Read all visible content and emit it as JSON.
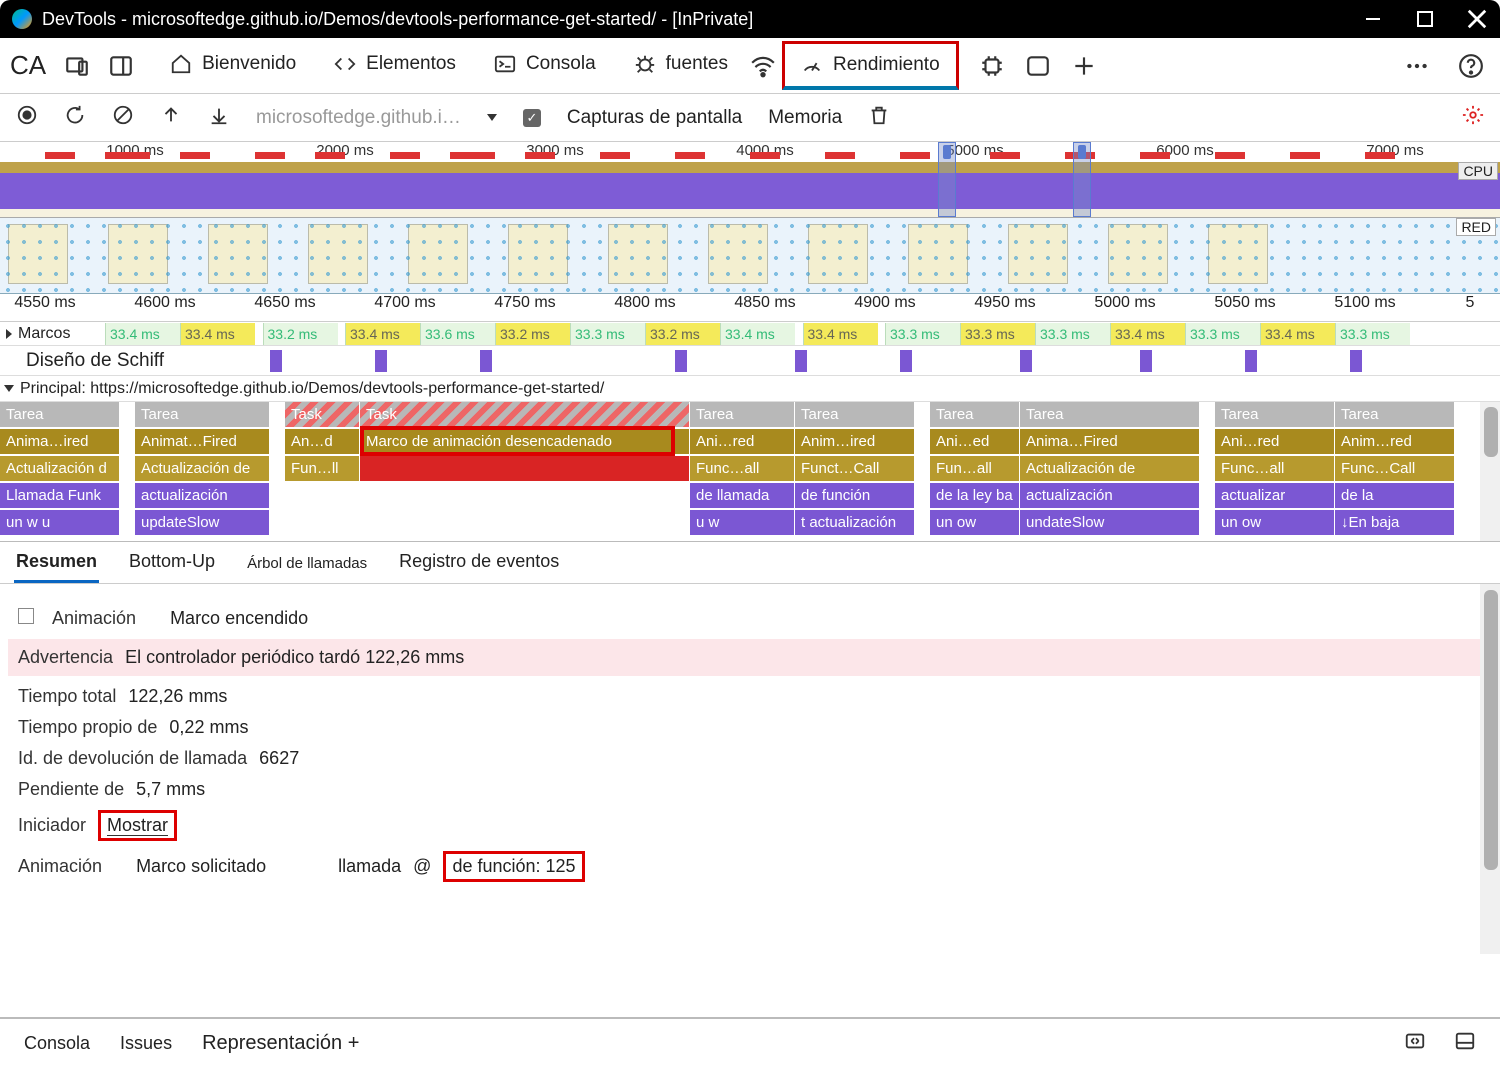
{
  "window": {
    "title": "DevTools - microsoftedge.github.io/Demos/devtools-performance-get-started/ - [InPrivate]"
  },
  "toolbar": {
    "ca_label": "CA",
    "tabs": {
      "welcome": "Bienvenido",
      "elements": "Elementos",
      "console": "Consola",
      "sources": "fuentes",
      "performance": "Rendimiento"
    }
  },
  "rec": {
    "url": "microsoftedge.github.i…",
    "screenshots_label": "Capturas de pantalla",
    "memory_label": "Memoria"
  },
  "overview": {
    "ticks": [
      "1000 ms",
      "2000 ms",
      "3000 ms",
      "4000 ms",
      "5000 ms",
      "6000 ms",
      "7000 ms"
    ],
    "cpu_label": "CPU",
    "net_label": "RED"
  },
  "ruler_ticks": [
    "4550 ms",
    "4600 ms",
    "4650 ms",
    "4700 ms",
    "4750 ms",
    "4800 ms",
    "4850 ms",
    "4900 ms",
    "4950 ms",
    "5000 ms",
    "5050 ms",
    "5100 ms",
    "5"
  ],
  "frames": {
    "label": "Marcos",
    "chips": [
      "33.4 ms",
      "33.4 ms",
      "33.2 ms",
      "33.4 ms",
      "33.6 ms",
      "33.2 ms",
      "33.3 ms",
      "33.2 ms",
      "33.4 ms",
      "33.4 ms",
      "33.3 ms",
      "33.3 ms",
      "33.3 ms",
      "33.4 ms",
      "33.3 ms",
      "33.4 ms",
      "33.3 ms"
    ]
  },
  "schiff_label": "Diseño de Schiff",
  "main_thread": {
    "label": "Principal:",
    "url": "https://microsoftedge.github.io/Demos/devtools-performance-get-started/"
  },
  "flame": {
    "tasks": [
      "Tarea",
      "Tarea",
      "Task",
      "Task",
      "Tarea",
      "Tarea",
      "Tarea",
      "Tarea",
      "Tarea",
      "Tarea"
    ],
    "anim": [
      "Anima…ired",
      "Animat…Fired",
      "An…d",
      "Marco de animación desencadenado",
      "Ani…red",
      "Anim…ired",
      "Ani…ed",
      "Anima…Fired",
      "Ani…red",
      "Anim…red"
    ],
    "upd": [
      "Actualización d",
      "Actualización de",
      "Fun…ll",
      "",
      "Func…all",
      "Funct…Call",
      "Fun…all",
      "Actualización de",
      "Func…all",
      "Func…Call"
    ],
    "call": [
      "Llamada Funk",
      "actualización",
      "",
      "",
      "de llamada",
      "de función",
      "de la ley ba",
      "actualización",
      "actualizar",
      "de la"
    ],
    "low": [
      "un w u",
      "updateSlow",
      "",
      "",
      "u w",
      "t actualización",
      "un ow",
      "undateSlow",
      "un ow",
      "↓En baja"
    ]
  },
  "bottom_tabs": {
    "summary": "Resumen",
    "bottomup": "Bottom-Up",
    "calltree": "Árbol de llamadas",
    "eventlog": "Registro de eventos"
  },
  "summary": {
    "cat": "Animación",
    "event": "Marco encendido",
    "warn_label": "Advertencia",
    "warn_text": "El controlador periódico tardó 122,26 mms",
    "total_label": "Tiempo total",
    "total_val": "122,26 mms",
    "self_label": "Tiempo propio de",
    "self_val": "0,22 mms",
    "cbid_label": "Id. de devolución de llamada",
    "cbid_val": "6627",
    "pending_label": "Pendiente de",
    "pending_val": "5,7 mms",
    "initiator_label": "Iniciador",
    "initiator_link": "Mostrar",
    "anim2_label": "Animación",
    "anim2_val": "Marco solicitado",
    "call_label": "llamada",
    "at": "@",
    "func_link": "de función: 125"
  },
  "drawer": {
    "console": "Consola",
    "issues": "Issues",
    "rendering": "Representación +"
  }
}
